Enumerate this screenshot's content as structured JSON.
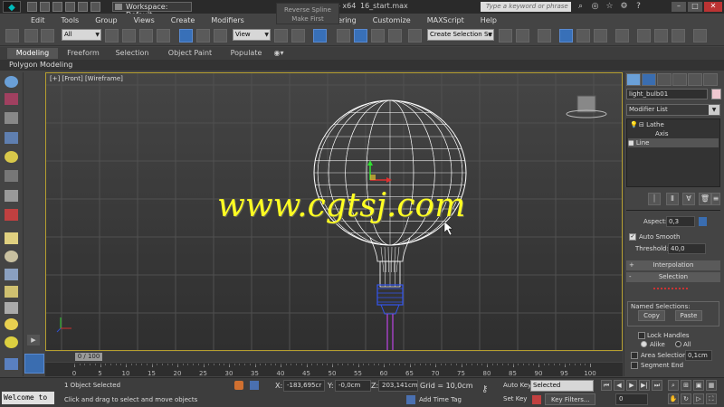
{
  "titlebar": {
    "workspace": "Workspace: Default",
    "title_x64": "- x64",
    "filename": "16_start.max",
    "search_placeholder": "Type a keyword or phrase"
  },
  "tooltip": {
    "line1": "Reverse Spline",
    "line2": "Make First"
  },
  "menu": [
    "Edit",
    "Tools",
    "Group",
    "Views",
    "Create",
    "Modifiers",
    "Rendering",
    "Customize",
    "MAXScript",
    "Help"
  ],
  "toolbar": {
    "selection_filter": "All",
    "ref_coord": "View",
    "named_selection_placeholder": "Create Selection Se"
  },
  "ribbon": {
    "tabs": [
      "Modeling",
      "Freeform",
      "Selection",
      "Object Paint",
      "Populate"
    ],
    "panel": "Polygon Modeling"
  },
  "viewport": {
    "label": "[+] [Front] [Wireframe]"
  },
  "watermark": "www.cgtsj.com",
  "timeline": {
    "slider_label": "0 / 100",
    "ticks": [
      "0",
      "5",
      "10",
      "15",
      "20",
      "25",
      "30",
      "35",
      "40",
      "45",
      "50",
      "55",
      "60",
      "65",
      "70",
      "75",
      "80",
      "85",
      "90",
      "95",
      "100"
    ]
  },
  "status": {
    "maxscript": "Welcome to M",
    "selected": "1 Object Selected",
    "prompt": "Click and drag to select and move objects",
    "x_label": "X:",
    "x": "-183,695cr",
    "y_label": "Y:",
    "y": "-0,0cm",
    "z_label": "Z:",
    "z": "203,141cm",
    "grid": "Grid = 10,0cm",
    "add_time_tag": "Add Time Tag",
    "auto_key": "Auto Key",
    "set_key": "Set Key",
    "key_mode": "Selected",
    "key_filters": "Key Filters...",
    "frame": "0"
  },
  "command_panel": {
    "object_name": "light_bulb01",
    "object_color": "#f0c8d0",
    "modifier_list": "Modifier List",
    "stack": [
      "Lathe",
      "Axis",
      "Line"
    ],
    "aspect_label": "Aspect:",
    "aspect": "0,3",
    "auto_smooth": "Auto Smooth",
    "threshold_label": "Threshold:",
    "threshold": "40,0",
    "rollout_interpolation": "Interpolation",
    "rollout_selection": "Selection",
    "rollout_sign_plus": "+",
    "rollout_sign_minus": "-",
    "named_selections": "Named Selections:",
    "copy": "Copy",
    "paste": "Paste",
    "lock_handles": "Lock Handles",
    "alike": "Alike",
    "all": "All",
    "area_selection": "Area Selection:",
    "area_value": "0,1cm",
    "segment_end": "Segment End"
  },
  "colors": {
    "viewport_border": "#b59e2f",
    "wire_white": "#ffffff",
    "wire_blue": "#3355ee",
    "wire_purple": "#a040c0",
    "accent_blue": "#3870b8"
  },
  "window_buttons": {
    "minimize": "–",
    "maximize": "□",
    "close": "✕"
  },
  "misc": {
    "logo_glyph": "◆",
    "playback": [
      "⏮",
      "◀",
      "▶",
      "▶|",
      "⏭"
    ]
  }
}
